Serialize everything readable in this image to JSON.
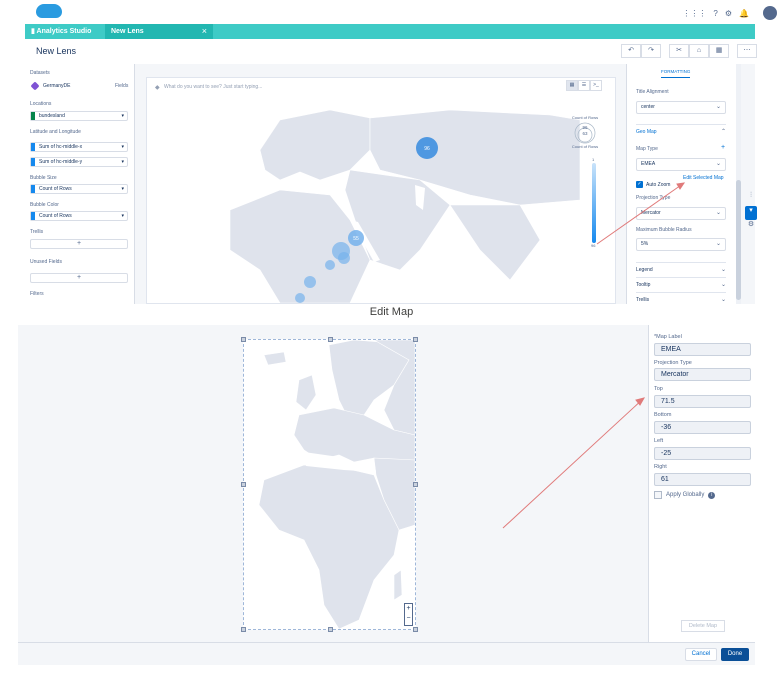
{
  "header": {
    "util_icons": [
      "⋮⋮⋮",
      "?",
      "⚙",
      "🔔"
    ],
    "app_tab": "Analytics Studio",
    "lens_tab": "New Lens",
    "tab_close": "×"
  },
  "lens": {
    "title": "New Lens",
    "toolbar": [
      "↶",
      "↷",
      "✂",
      "⌂",
      "▦",
      "⋯"
    ]
  },
  "left_panel": {
    "datasets_label": "Datasets",
    "dataset_name": "GermanyDE",
    "fields_link": "Fields",
    "locations_label": "Locations",
    "location_value": "bundesland",
    "latlon_label": "Latitude and Longitude",
    "lat_value": "Sum of hc-middle-x",
    "lon_value": "Sum of hc-middle-y",
    "bubble_size_label": "Bubble Size",
    "bubble_size_value": "Count of Rows",
    "bubble_color_label": "Bubble Color",
    "bubble_color_value": "Count of Rows",
    "trellis_label": "Trellis",
    "unused_label": "Unused Fields",
    "filters_label": "Filters",
    "add": "+"
  },
  "canvas": {
    "search_placeholder": "What do you want to see? Just start typing...",
    "view_toggles": [
      "▦",
      "☰",
      ">_"
    ],
    "bubbles": [
      "96",
      "55"
    ],
    "legend_size_title": "Count of Rows",
    "legend_size_values": [
      "96",
      "63"
    ],
    "legend_color_title": "Count of Rows",
    "legend_color_min": "1",
    "legend_color_max": "96"
  },
  "format_panel": {
    "tab": "FORMATTING",
    "title_alignment_label": "Title Alignment",
    "title_alignment_value": "center",
    "geo_map_section": "Geo Map",
    "map_type_label": "Map Type",
    "map_type_add": "+",
    "map_type_value": "EMEA",
    "auto_zoom_label": "Auto Zoom",
    "edit_selected_map": "Edit Selected Map",
    "projection_label": "Projection Type",
    "projection_value": "Mercator",
    "max_bubble_label": "Maximum Bubble Radius",
    "max_bubble_value": "5%",
    "sections": [
      "Legend",
      "Tooltip",
      "Trellis"
    ]
  },
  "caption": "Edit Map",
  "edit_map": {
    "map_label_label": "*Map Label",
    "map_label_value": "EMEA",
    "projection_label": "Projection Type",
    "projection_value": "Mercator",
    "top_label": "Top",
    "top_value": "71.5",
    "bottom_label": "Bottom",
    "bottom_value": "-36",
    "left_label": "Left",
    "left_value": "-25",
    "right_label": "Right",
    "right_value": "61",
    "apply_globally": "Apply Globally",
    "info": "i",
    "delete_map": "Delete Map",
    "zoom_in": "+",
    "zoom_out": "−",
    "cancel": "Cancel",
    "done": "Done"
  },
  "colors": {
    "accent": "#0070d2",
    "tab_bar": "#3ecbc6",
    "annotation_arrow": "#e07a7a",
    "bubble": "#1589ee"
  }
}
